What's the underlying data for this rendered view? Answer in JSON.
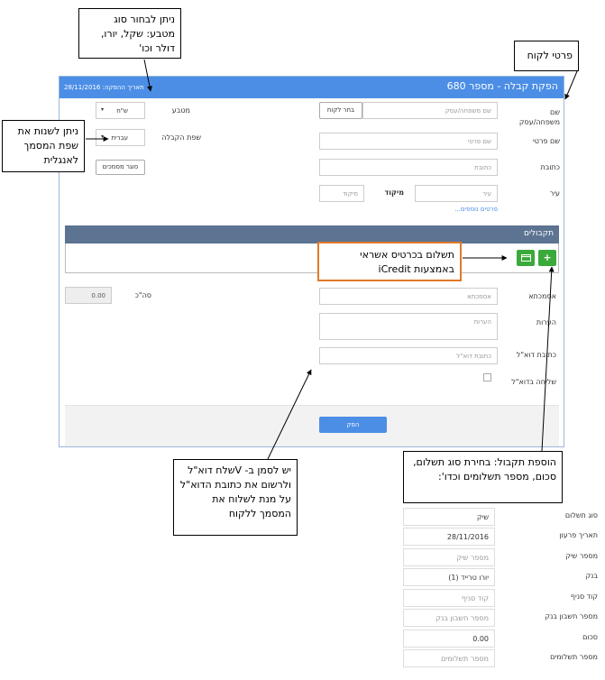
{
  "form": {
    "title": "הפקת קבלה - מספר 680",
    "date_label": "תאריך ההפקה: 28/11/2016",
    "customer_name_label": "שם משפחה/עסק",
    "customer_name_placeholder": "שם משפחה/עסק",
    "choose_customer_button": "בחר לקוח",
    "first_name_label": "שם פרטי",
    "first_name_placeholder": "שם פרטי",
    "address_label": "כתובת",
    "address_placeholder": "כתובת",
    "city_label": "עיר",
    "city_placeholder": "עיר",
    "zip_label": "מיקוד",
    "zip_placeholder": "מיקוד",
    "more_details_link": "פרטים נוספים...",
    "currency_label": "מטבע",
    "currency_value": "ש\"ח",
    "language_label": "שפת הקבלה",
    "language_value": "עברית",
    "doc_type_button": "סוגר מסמכים",
    "payments_title": "תקבולים",
    "reference_label": "אסמכתא",
    "reference_placeholder": "אסמכתא",
    "notes_label": "הערות",
    "notes_placeholder": "הערות",
    "email_label": "כתובת דוא\"ל",
    "email_placeholder": "כתובת דוא\"ל",
    "send_email_label": "שליחה בדוא\"ל",
    "total_label": "סה\"כ",
    "total_value": "0.00",
    "submit_button": "הפק",
    "add_icon": "plus-icon",
    "card_icon": "credit-card-icon"
  },
  "callouts": {
    "currency": "ניתן לבחור סוג מטבע: שקל, יורו, דולר וכו'",
    "customer": "פרטי לקוח",
    "language": "ניתן לשנות את שפת המסמך לאנגלית",
    "credit": "תשלום בכרטיס אשראי באמצעות iCredit",
    "email": "יש לסמן ב- Vשלח דוא\"ל ולרשום את כתובת הדוא\"ל על מנת לשלוח את המסמך ללקוח",
    "payment": "הוספת תקבול: בחירת סוג תשלום, סכום, מספר תשלומים וכדו':"
  },
  "payment_panel": {
    "rows": [
      {
        "label": "סוג תשלום",
        "value": "שיק",
        "placeholder": false
      },
      {
        "label": "תאריך פרעון",
        "value": "28/11/2016",
        "placeholder": false
      },
      {
        "label": "מספר שיק",
        "value": "מספר שיק",
        "placeholder": true
      },
      {
        "label": "בנק",
        "value": "יורו טרייד (1)",
        "placeholder": false
      },
      {
        "label": "קוד סניף",
        "value": "קוד סניף",
        "placeholder": true
      },
      {
        "label": "מספר חשבון בנק",
        "value": "מספר חשבון בנק",
        "placeholder": true
      },
      {
        "label": "סכום",
        "value": "0.00",
        "placeholder": false
      },
      {
        "label": "מספר תשלומים",
        "value": "מספר תשלומים",
        "placeholder": true
      }
    ]
  },
  "colors": {
    "header_blue": "#4c8ee6",
    "payments_header": "#5c7391",
    "add_green": "#3aaa3a",
    "callout_orange": "#e07a2a"
  }
}
